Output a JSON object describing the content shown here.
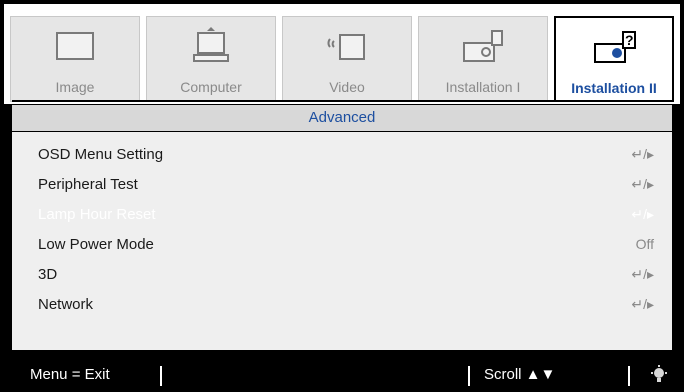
{
  "tabs": [
    {
      "label": "Image",
      "icon": "image-icon"
    },
    {
      "label": "Computer",
      "icon": "computer-icon"
    },
    {
      "label": "Video",
      "icon": "video-icon"
    },
    {
      "label": "Installation I",
      "icon": "installation-i-icon"
    },
    {
      "label": "Installation II",
      "icon": "installation-ii-icon"
    }
  ],
  "active_tab": "Installation II",
  "section_title": "Advanced",
  "menu_items": [
    {
      "label": "OSD Menu Setting",
      "value": "↵/▸"
    },
    {
      "label": "Peripheral Test",
      "value": "↵/▸"
    },
    {
      "label": "Lamp Hour Reset",
      "value": "↵/▸"
    },
    {
      "label": "Low Power Mode",
      "value": "Off"
    },
    {
      "label": "3D",
      "value": "↵/▸"
    },
    {
      "label": "Network",
      "value": "↵/▸"
    }
  ],
  "status": {
    "menu_exit": "Menu = Exit",
    "scroll": "Scroll ▲▼"
  },
  "colors": {
    "accent": "#1d4fa0",
    "selected_text": "#ffffff",
    "value_gray": "#8a8a8a"
  }
}
